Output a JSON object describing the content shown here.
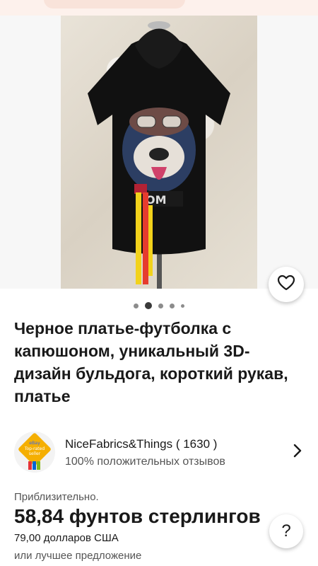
{
  "listing": {
    "title": "Черное платье-футболка с капюшоном, уникальный 3D-дизайн бульдога, короткий рукав, платье",
    "image_count": 5,
    "active_image_index": 1
  },
  "seller": {
    "badge_text": "eBay Top-rated seller",
    "name": "NiceFabrics&Things ( 1630 )",
    "feedback": "100% положительных отзывов"
  },
  "pricing": {
    "approx_label": "Приблизительно.",
    "price": "58,84 фунтов стерлингов",
    "price_usd": "79,00 долларов США",
    "offer": "или лучшее предложение"
  },
  "icons": {
    "favorite": "heart-icon",
    "seller_chevron": "chevron-right-icon",
    "help": "help-icon"
  },
  "colors": {
    "accent": "#191919",
    "badge_blue": "#3665f3",
    "badge_gold": "#f5af02"
  }
}
